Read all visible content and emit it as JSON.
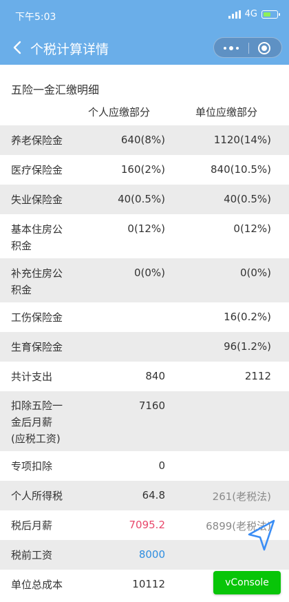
{
  "status_bar": {
    "time": "下午5:03",
    "network": "4G"
  },
  "nav": {
    "title": "个税计算详情"
  },
  "section": {
    "title": "五险一金汇缴明细",
    "col_personal": "个人应缴部分",
    "col_company": "单位应缴部分"
  },
  "rows": [
    {
      "label": "养老保险金",
      "personal": "640(8%)",
      "company": "1120(14%)"
    },
    {
      "label": "医疗保险金",
      "personal": "160(2%)",
      "company": "840(10.5%)"
    },
    {
      "label": "失业保险金",
      "personal": "40(0.5%)",
      "company": "40(0.5%)"
    },
    {
      "label_l1": "基本住房公",
      "label_l2": "积金",
      "personal": "0(12%)",
      "company": "0(12%)"
    },
    {
      "label_l1": "补充住房公",
      "label_l2": "积金",
      "personal": "0(0%)",
      "company": "0(0%)"
    },
    {
      "label": "工伤保险金",
      "personal": "",
      "company": "16(0.2%)"
    },
    {
      "label": "生育保险金",
      "personal": "",
      "company": "96(1.2%)"
    },
    {
      "label": "共计支出",
      "personal": "840",
      "company": "2112"
    },
    {
      "label_l1": "扣除五险一",
      "label_l2": "金后月薪",
      "label_l3": "(应税工资)",
      "personal": "7160",
      "company": ""
    },
    {
      "label": "专项扣除",
      "personal": "0",
      "company": ""
    },
    {
      "label": "个人所得税",
      "personal": "64.8",
      "company": "261(老税法)"
    },
    {
      "label": "税后月薪",
      "personal": "7095.2",
      "company": "6899(老税法)"
    },
    {
      "label": "税前工资",
      "personal": "8000",
      "company": ""
    },
    {
      "label": "单位总成本",
      "personal": "10112",
      "company": ""
    }
  ],
  "vconsole": {
    "label": "vConsole"
  },
  "colors": {
    "header": "#6aaee9",
    "red_value": "#e8476b",
    "blue_value": "#2f8ee0",
    "vconsole": "#08c508"
  }
}
